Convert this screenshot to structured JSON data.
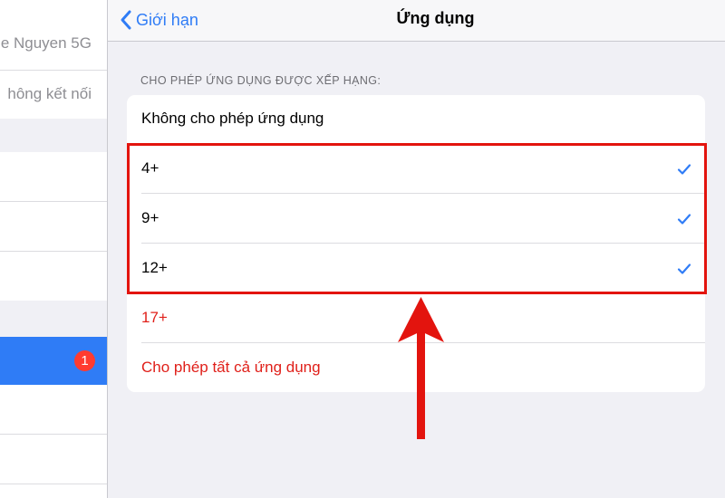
{
  "sidebar": {
    "items": [
      {
        "label": "e Nguyen 5G"
      },
      {
        "label": "hông kết nối"
      }
    ],
    "badge": "1",
    "selected_color": "#2f7cf6"
  },
  "navbar": {
    "back_label": "Giới hạn",
    "title": "Ứng dụng"
  },
  "section": {
    "header": "CHO PHÉP ỨNG DỤNG ĐƯỢC XẾP HẠNG:"
  },
  "options": [
    {
      "label": "Không cho phép ứng dụng",
      "checked": false,
      "color": "#000000"
    },
    {
      "label": "4+",
      "checked": true,
      "color": "#000000"
    },
    {
      "label": "9+",
      "checked": true,
      "color": "#000000"
    },
    {
      "label": "12+",
      "checked": true,
      "color": "#000000"
    },
    {
      "label": "17+",
      "checked": false,
      "color": "#e0201a"
    },
    {
      "label": "Cho phép tất cả ứng dụng",
      "checked": false,
      "color": "#e0201a"
    }
  ],
  "colors": {
    "accent": "#2f7cf6",
    "destructive": "#e0201a",
    "annotation": "#e3140e"
  }
}
